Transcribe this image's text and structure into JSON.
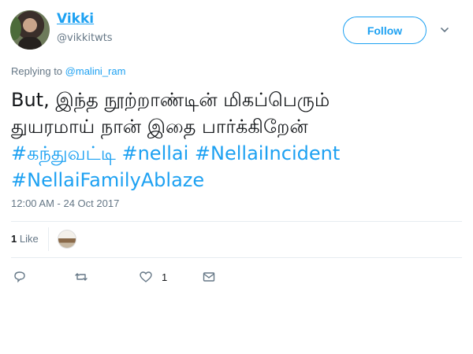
{
  "user": {
    "name": "Vikki",
    "handle": "@vikkitwts"
  },
  "follow_label": "Follow",
  "reply": {
    "prefix": "Replying to",
    "mention": "@malini_ram"
  },
  "tweet": {
    "line1": "But, இந்த நூற்றாண்டின் மிகப்பெரும்",
    "line2": "துயரமாய் நான் இதை பார்க்கிறேன்",
    "line3_tags": [
      "#கந்துவட்டி",
      "#nellai",
      "#NellaiIncident"
    ],
    "line4_tags": [
      "#NellaiFamilyAblaze"
    ]
  },
  "timestamp": "12:00 AM - 24 Oct 2017",
  "stats": {
    "likes_count": "1",
    "likes_label": "Like"
  },
  "actions": {
    "like_count": "1"
  },
  "colors": {
    "accent": "#1da1f2",
    "muted": "#657786",
    "text": "#14171a",
    "divider": "#e6ecf0"
  },
  "icons": {
    "more": "chevron-down-icon",
    "reply": "reply-icon",
    "retweet": "retweet-icon",
    "like": "heart-icon",
    "dm": "envelope-icon"
  }
}
